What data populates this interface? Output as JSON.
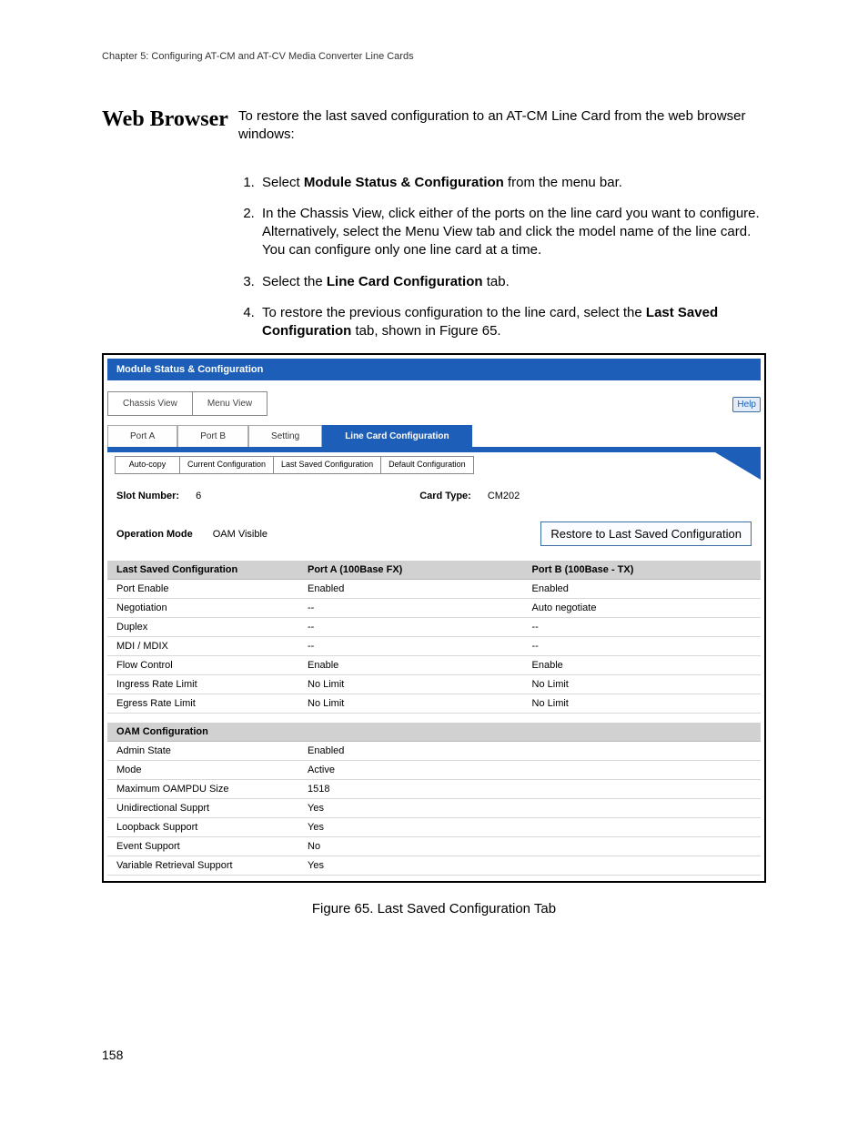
{
  "chapter": "Chapter 5: Configuring AT-CM and AT-CV Media Converter Line Cards",
  "heading": "Web Browser",
  "intro": "To restore the last saved configuration to an AT-CM Line Card from the web browser windows:",
  "steps": {
    "s1a": "Select ",
    "s1b": "Module Status & Configuration",
    "s1c": " from the menu bar.",
    "s2": "In the Chassis View, click either of the ports on the line card you want to configure. Alternatively, select the Menu View tab and click the model name of the line card. You can configure only one line card at a time.",
    "s3a": "Select the ",
    "s3b": "Line Card Configuration",
    "s3c": " tab.",
    "s4a": "To restore the previous configuration to the line card, select the ",
    "s4b": "Last Saved Configuration",
    "s4c": " tab, shown in Figure 65."
  },
  "shot": {
    "title": "Module Status & Configuration",
    "view_tabs": [
      "Chassis View",
      "Menu View"
    ],
    "help": "Help",
    "main_tabs": [
      "Port A",
      "Port B",
      "Setting",
      "Line Card Configuration"
    ],
    "sub_tabs": [
      "Auto-copy",
      "Current Configuration",
      "Last Saved Configuration",
      "Default Configuration"
    ],
    "slot_label": "Slot Number:",
    "slot_val": "6",
    "card_label": "Card Type:",
    "card_val": "CM202",
    "op_label": "Operation Mode",
    "op_val": "OAM Visible",
    "restore": "Restore to Last Saved Configuration",
    "table1": {
      "headers": [
        "Last Saved Configuration",
        "Port A (100Base FX)",
        "Port B (100Base - TX)"
      ],
      "rows": [
        [
          "Port Enable",
          "Enabled",
          "Enabled"
        ],
        [
          "Negotiation",
          "--",
          "Auto negotiate"
        ],
        [
          "Duplex",
          "--",
          "--"
        ],
        [
          "MDI / MDIX",
          "--",
          "--"
        ],
        [
          "Flow Control",
          "Enable",
          "Enable"
        ],
        [
          "Ingress Rate Limit",
          "No Limit",
          "No Limit"
        ],
        [
          "Egress Rate Limit",
          "No Limit",
          "No Limit"
        ]
      ]
    },
    "table2": {
      "header": "OAM Configuration",
      "rows": [
        [
          "Admin State",
          "Enabled"
        ],
        [
          "Mode",
          "Active"
        ],
        [
          "Maximum OAMPDU Size",
          "1518"
        ],
        [
          "Unidirectional Supprt",
          "Yes"
        ],
        [
          "Loopback Support",
          "Yes"
        ],
        [
          "Event Support",
          "No"
        ],
        [
          "Variable Retrieval Support",
          "Yes"
        ]
      ]
    }
  },
  "caption": "Figure 65. Last Saved Configuration Tab",
  "pagenum": "158"
}
